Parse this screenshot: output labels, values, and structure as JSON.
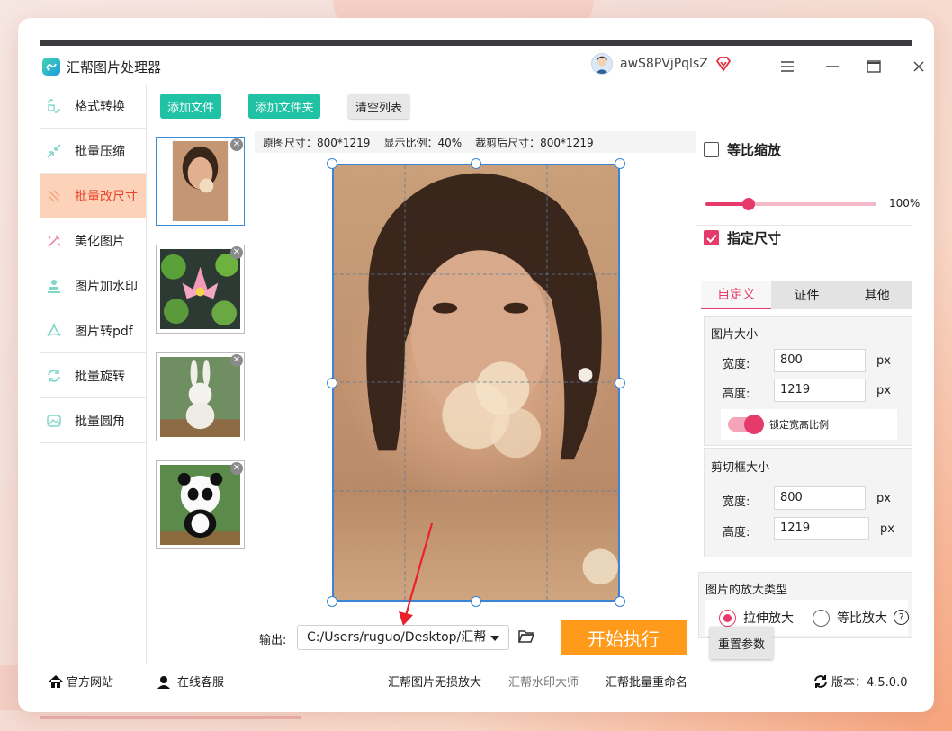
{
  "app": {
    "title": "汇帮图片处理器",
    "username": "awS8PVjPqlsZ",
    "brand_color": "#20c2a6",
    "accent_color": "#e63a6a"
  },
  "window_controls": [
    "menu-icon",
    "minimize-icon",
    "maximize-icon",
    "close-icon"
  ],
  "sidebar": {
    "items": [
      {
        "label": "格式转换",
        "icon": "format-convert-icon",
        "active": false
      },
      {
        "label": "批量压缩",
        "icon": "compress-icon",
        "active": false
      },
      {
        "label": "批量改尺寸",
        "icon": "resize-icon",
        "active": true
      },
      {
        "label": "美化图片",
        "icon": "beautify-icon",
        "active": false
      },
      {
        "label": "图片加水印",
        "icon": "watermark-icon",
        "active": false
      },
      {
        "label": "图片转pdf",
        "icon": "pdf-icon",
        "active": false
      },
      {
        "label": "批量旋转",
        "icon": "rotate-icon",
        "active": false
      },
      {
        "label": "批量圆角",
        "icon": "rounded-corner-icon",
        "active": false
      }
    ]
  },
  "toolbar": {
    "add_file": "添加文件",
    "add_folder": "添加文件夹",
    "clear_list": "清空列表"
  },
  "thumbnails": [
    {
      "name": "portrait",
      "selected": true
    },
    {
      "name": "lotus",
      "selected": false
    },
    {
      "name": "rabbit",
      "selected": false
    },
    {
      "name": "panda",
      "selected": false
    }
  ],
  "info": {
    "original_size": "原图尺寸：800*1219",
    "display_ratio": "显示比例：40%",
    "cropped_size": "裁剪后尺寸：800*1219"
  },
  "output": {
    "label": "输出:",
    "path": "C:/Users/ruguo/Desktop/汇帮",
    "start": "开始执行"
  },
  "right": {
    "proportional_scale": "等比缩放",
    "proportional_checked": false,
    "scale_percent": 25,
    "scale_value": "100%",
    "specify_size": "指定尺寸",
    "specify_checked": true,
    "tabs": [
      "自定义",
      "证件",
      "其他"
    ],
    "active_tab": 0,
    "image_size": {
      "title": "图片大小",
      "width_label": "宽度:",
      "width": "800",
      "height_label": "高度:",
      "height": "1219",
      "unit": "px",
      "lock_label": "锁定宽高比例",
      "locked": true
    },
    "crop_size": {
      "title": "剪切框大小",
      "width_label": "宽度:",
      "width": "800",
      "height_label": "高度:",
      "height": "1219",
      "unit": "px"
    },
    "enlarge": {
      "title": "图片的放大类型",
      "stretch": "拉伸放大",
      "proportional": "等比放大",
      "selected": "stretch"
    },
    "reset": "重置参数"
  },
  "footer": {
    "website": "官方网站",
    "service": "在线客服",
    "link1": "汇帮图片无损放大",
    "link2": "汇帮水印大师",
    "link3": "汇帮批量重命名",
    "version": "版本：4.5.0.0"
  }
}
